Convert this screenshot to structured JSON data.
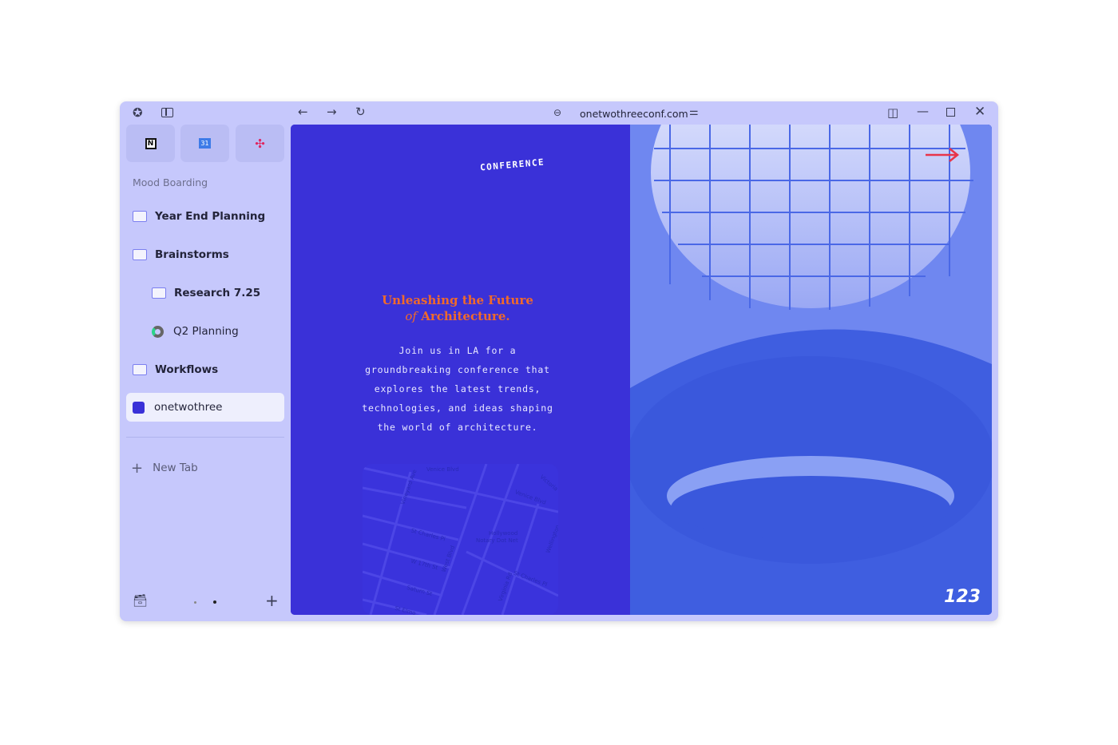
{
  "browser": {
    "url": "onetwothreeconf.com"
  },
  "pinned": [
    {
      "name": "Notion",
      "icon": "notion-icon"
    },
    {
      "name": "Google Calendar",
      "icon": "calendar-icon",
      "label": "31"
    },
    {
      "name": "Slack",
      "icon": "slack-icon"
    }
  ],
  "sidebar": {
    "section": "Mood Boarding",
    "items": [
      {
        "label": "Year End Planning"
      },
      {
        "label": "Brainstorms"
      },
      {
        "label": "Research 7.25"
      },
      {
        "label": "Q2 Planning"
      },
      {
        "label": "Workflows"
      },
      {
        "label": "onetwothree"
      }
    ],
    "new_tab": "New Tab"
  },
  "page": {
    "brand": "CONFERENCE",
    "headline1": "Unleashing the Future",
    "headline2_em": "of",
    "headline2": " Architecture.",
    "body": [
      "Join us in LA for a",
      "groundbreaking conference that",
      "explores the latest trends,",
      "technologies, and ideas shaping",
      "the world of architecture."
    ],
    "map_labels": [
      "Venice Blvd",
      "Venice Blvd",
      "Victoria",
      "Vineyard Ave",
      "St Charles Pl",
      "W 17th St",
      "West Blvd",
      "Hollywood",
      "Notary Dot Net",
      "Saturn St",
      "Virginia Rd",
      "St Charles Pl",
      "Wellington",
      "St Elmo"
    ],
    "logo": "123",
    "accent": "#3a31d8",
    "headline_color": "#f06a2b"
  }
}
